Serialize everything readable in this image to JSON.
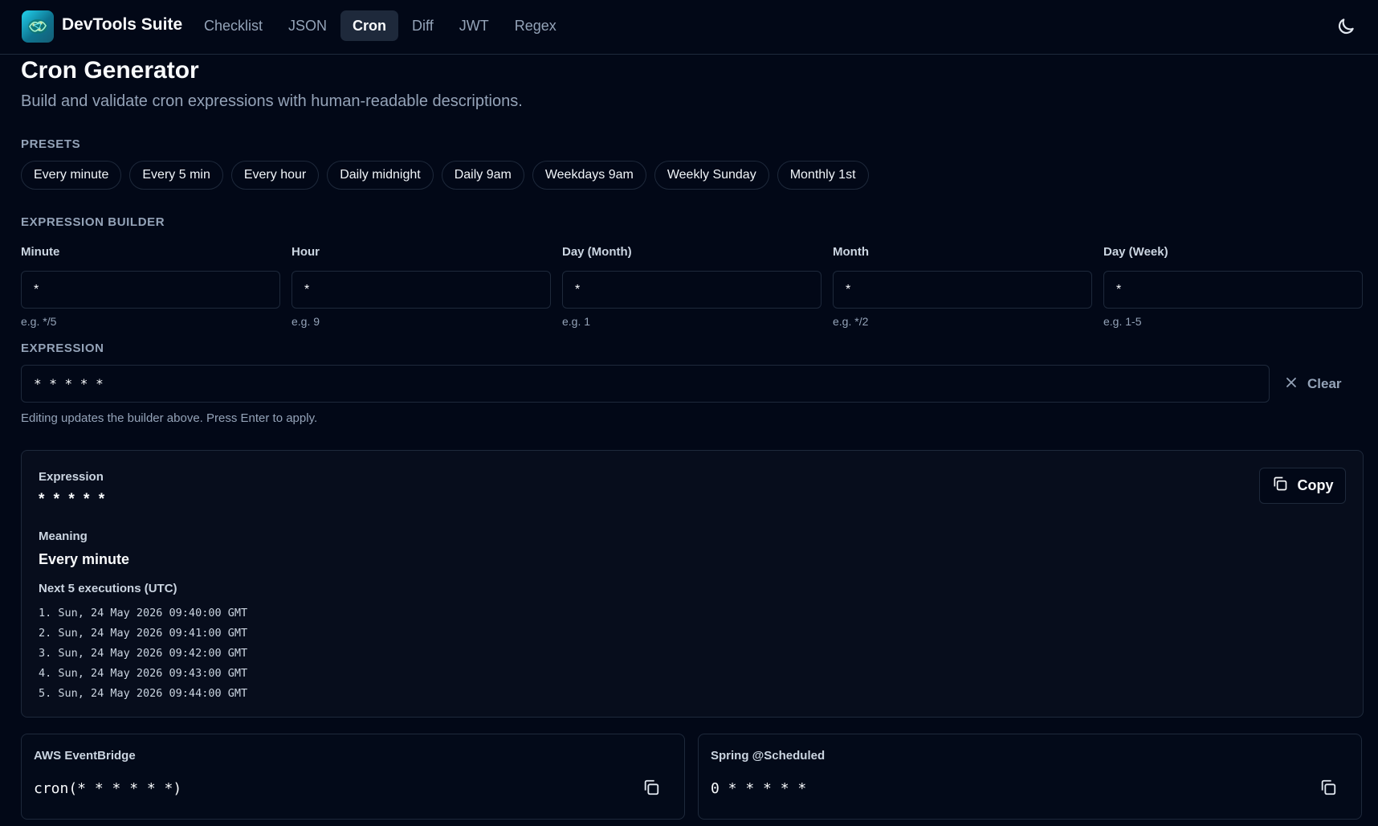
{
  "app": {
    "title": "DevTools Suite",
    "nav": [
      "Checklist",
      "JSON",
      "Cron",
      "Diff",
      "JWT",
      "Regex"
    ],
    "active_nav": "Cron",
    "icons": {
      "logo": "brain-circuit-icon",
      "theme": "moon-icon"
    }
  },
  "page": {
    "title": "Cron Generator",
    "subtitle": "Build and validate cron expressions with human-readable descriptions."
  },
  "presets": {
    "label": "PRESETS",
    "items": [
      "Every minute",
      "Every 5 min",
      "Every hour",
      "Daily midnight",
      "Daily 9am",
      "Weekdays 9am",
      "Weekly Sunday",
      "Monthly 1st"
    ]
  },
  "builder": {
    "label": "EXPRESSION BUILDER",
    "fields": [
      {
        "label": "Minute",
        "value": "*",
        "hint": "e.g. */5"
      },
      {
        "label": "Hour",
        "value": "*",
        "hint": "e.g. 9"
      },
      {
        "label": "Day (Month)",
        "value": "*",
        "hint": "e.g. 1"
      },
      {
        "label": "Month",
        "value": "*",
        "hint": "e.g. */2"
      },
      {
        "label": "Day (Week)",
        "value": "*",
        "hint": "e.g. 1-5"
      }
    ]
  },
  "expression": {
    "label": "EXPRESSION",
    "value": "* * * * *",
    "clear_label": "Clear",
    "help": "Editing updates the builder above. Press Enter to apply."
  },
  "result": {
    "expression_label": "Expression",
    "expression": "* * * * *",
    "meaning_label": "Meaning",
    "meaning": "Every minute",
    "runs_label": "Next 5 executions (UTC)",
    "runs": [
      "1. Sun, 24 May 2026 09:40:00 GMT",
      "2. Sun, 24 May 2026 09:41:00 GMT",
      "3. Sun, 24 May 2026 09:42:00 GMT",
      "4. Sun, 24 May 2026 09:43:00 GMT",
      "5. Sun, 24 May 2026 09:44:00 GMT"
    ],
    "copy_label": "Copy"
  },
  "formats": {
    "aws": {
      "label": "AWS EventBridge",
      "value": "cron(* * * * * *)"
    },
    "spring": {
      "label": "Spring @Scheduled",
      "value": "0 * * * * *"
    }
  }
}
